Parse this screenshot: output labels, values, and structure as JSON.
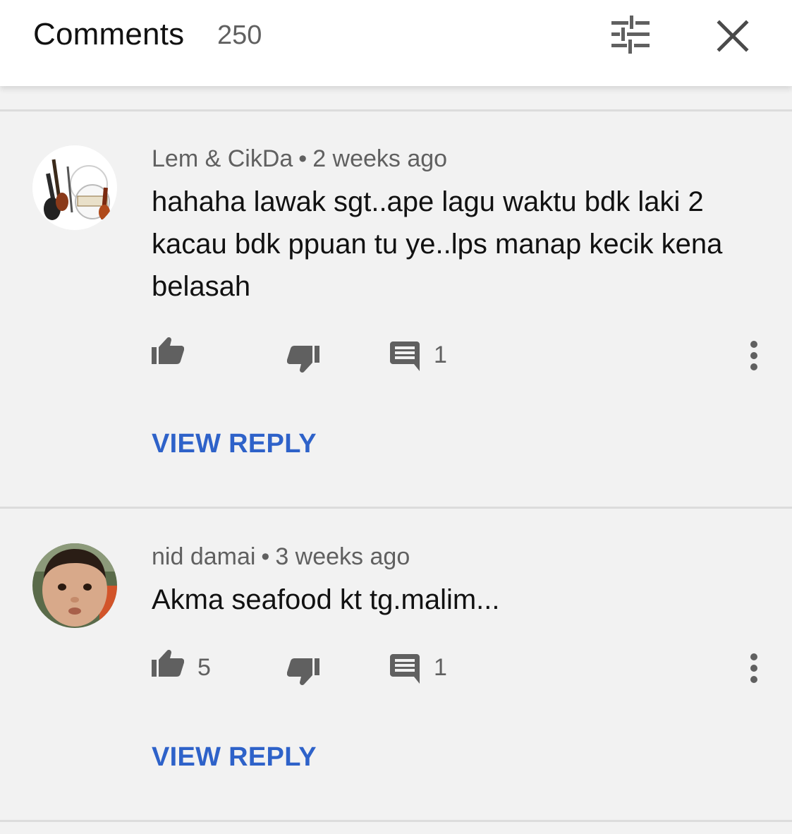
{
  "header": {
    "title": "Comments",
    "count": "250",
    "filter_icon": "sliders-icon",
    "close_icon": "close-icon"
  },
  "comments": [
    {
      "author": "Lem & CikDa",
      "separator": "•",
      "time": "2 weeks ago",
      "text": "hahaha lawak sgt..ape lagu waktu bdk laki 2 kacau bdk ppuan tu ye..lps manap kecik kena belasah",
      "likes": "",
      "replies": "1",
      "view_reply": "VIEW REPLY"
    },
    {
      "author": "nid damai",
      "separator": "•",
      "time": "3 weeks ago",
      "text": "Akma seafood kt tg.malim...",
      "likes": "5",
      "replies": "1",
      "view_reply": "VIEW REPLY"
    }
  ],
  "colors": {
    "link": "#2e62c9",
    "icon": "#606060",
    "background": "#f2f2f2"
  }
}
